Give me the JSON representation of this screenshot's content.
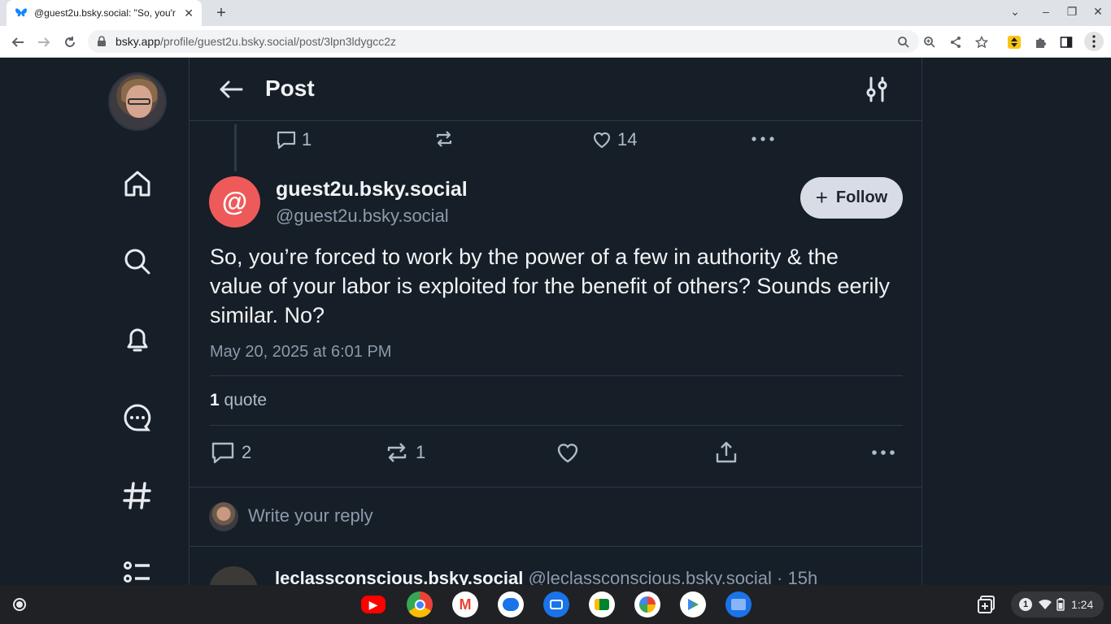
{
  "browser": {
    "tab_title": "@guest2u.bsky.social: \"So, you'r",
    "url_domain": "bsky.app",
    "url_path": "/profile/guest2u.bsky.social/post/3lpn3ldygcc2z"
  },
  "header": {
    "title": "Post"
  },
  "parent_post": {
    "reply_count": "1",
    "like_count": "14"
  },
  "post": {
    "author_initial": "@",
    "author_display": "guest2u.bsky.social",
    "author_handle": "@guest2u.bsky.social",
    "follow_label": "Follow",
    "text": "So, you’re forced to work by the power of a few in authority & the value of your labor is exploited for the benefit of others? Sounds eerily similar. No?",
    "timestamp": "May 20, 2025 at 6:01 PM",
    "quote_count": "1",
    "quote_label": "quote",
    "reply_count": "2",
    "repost_count": "1"
  },
  "reply_box": {
    "placeholder": "Write your reply"
  },
  "next_reply": {
    "display": "leclassconscious.bsky.social",
    "meta": "@leclassconscious.bsky.social · 15h"
  },
  "shelf": {
    "notification_count": "1",
    "time": "1:24"
  },
  "colors": {
    "background": "#161e27",
    "accent_avatar": "#ee5a5a",
    "follow_button": "#d8dde5"
  }
}
